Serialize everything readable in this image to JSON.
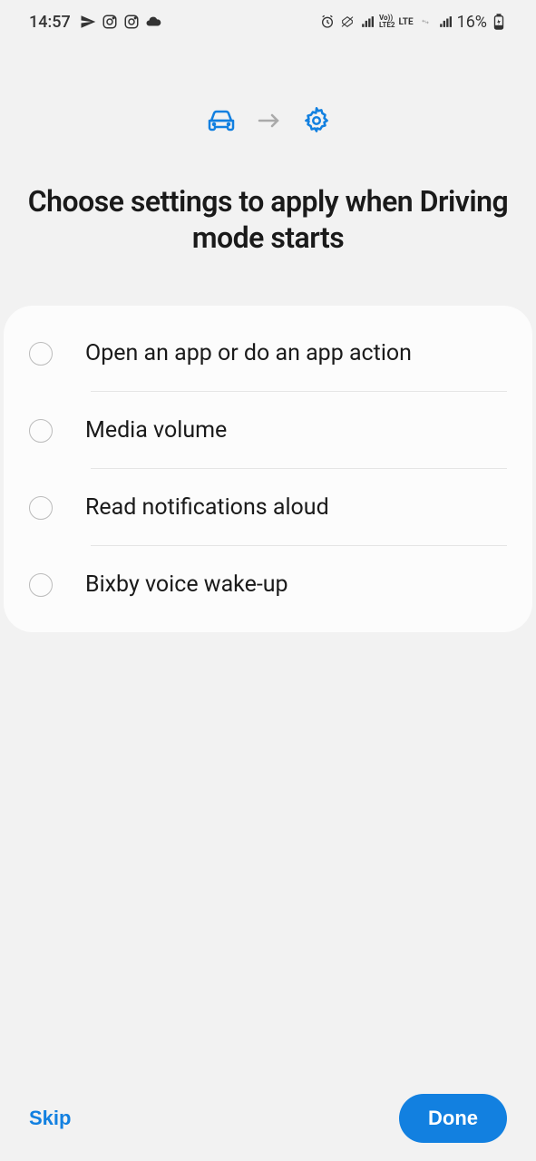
{
  "status_bar": {
    "time": "14:57",
    "battery": "16%",
    "lte_top": "Vo))",
    "lte_bottom": "LTE2",
    "lte_label": "LTE"
  },
  "header": {
    "title": "Choose settings to apply when Driving mode starts"
  },
  "options": [
    {
      "label": "Open an app or do an app action"
    },
    {
      "label": "Media volume"
    },
    {
      "label": "Read notifications aloud"
    },
    {
      "label": "Bixby voice wake-up"
    }
  ],
  "buttons": {
    "skip": "Skip",
    "done": "Done"
  }
}
